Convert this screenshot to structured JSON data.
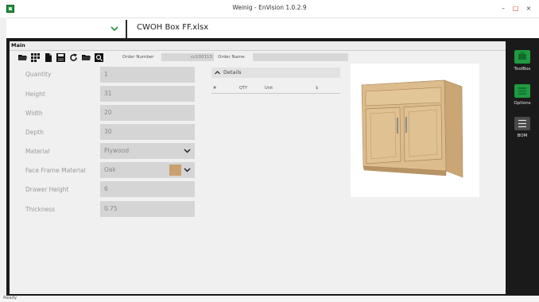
{
  "window": {
    "title": "Weinig - EnVision 1.0.2.9",
    "min": "–",
    "max": "□",
    "close": "×"
  },
  "file": {
    "name": "CWOH Box FF.xlsx"
  },
  "main": {
    "label": "Main"
  },
  "order": {
    "number_label": "Order Number",
    "number_value": "cc100113",
    "name_label": "Order Name",
    "name_value": ""
  },
  "form": {
    "fields": [
      {
        "label": "Quantity",
        "value": "1"
      },
      {
        "label": "Height",
        "value": "31"
      },
      {
        "label": "Width",
        "value": "20"
      },
      {
        "label": "Depth",
        "value": "30"
      },
      {
        "label": "Material",
        "value": "Plywood"
      },
      {
        "label": "Face Frame Material",
        "value": "Oak"
      },
      {
        "label": "Drawer Height",
        "value": "6"
      },
      {
        "label": "Thickness",
        "value": "0.75"
      }
    ],
    "face_frame_swatch_color": "#c9a06e"
  },
  "details": {
    "title": "Details",
    "columns": [
      "#",
      "QTY",
      "Unit",
      "$"
    ]
  },
  "sidebar": {
    "items": [
      {
        "label": "ToolBox",
        "icon": "toolbox-icon",
        "color": "#1f9a3f"
      },
      {
        "label": "Options",
        "icon": "options-icon",
        "color": "#1f9a3f"
      },
      {
        "label": "BOM",
        "icon": "bom-list-icon",
        "color": "#4a4a4a"
      }
    ]
  },
  "status": {
    "text": "Ready"
  },
  "colors": {
    "accent": "#1f9a3f",
    "frame": "#1a1a1a",
    "wood": "#d9b98a"
  }
}
